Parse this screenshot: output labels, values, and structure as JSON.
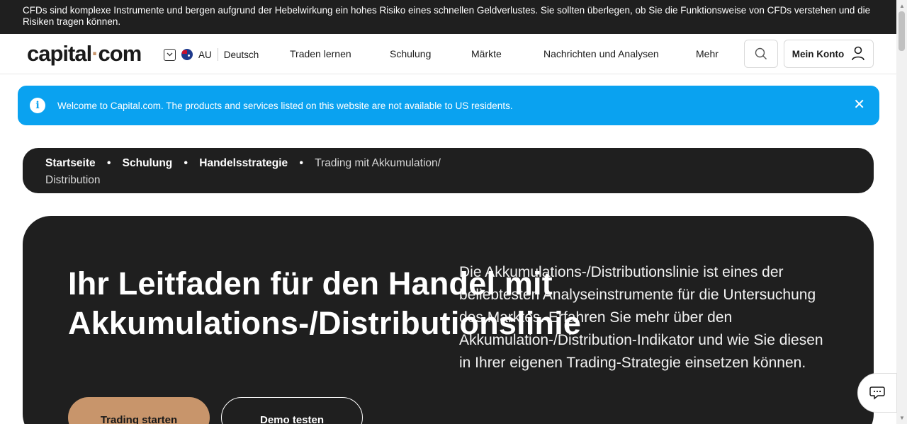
{
  "risk_warning": "CFDs sind komplexe Instrumente und bergen aufgrund der Hebelwirkung ein hohes Risiko eines schnellen Geldverlustes. Sie sollten überlegen, ob Sie die Funktionsweise von CFDs verstehen und die Risiken tragen können.",
  "header": {
    "logo_left": "capital",
    "logo_dot": "·",
    "logo_right": "com",
    "country": "AU",
    "language": "Deutsch",
    "nav": [
      "Traden lernen",
      "Schulung",
      "Märkte",
      "Nachrichten und Analysen",
      "Mehr"
    ],
    "account_label": "Mein Konto"
  },
  "notice": {
    "text": "Welcome to Capital.com. The products and services listed on this website are not available to US residents.",
    "info_symbol": "i",
    "close_symbol": "✕"
  },
  "breadcrumb": {
    "items": [
      "Startseite",
      "Schulung",
      "Handelsstrategie"
    ],
    "current": "Trading mit Akkumulation/ Distribution",
    "separator": "•"
  },
  "hero": {
    "title": "Ihr Leitfaden für den Handel mit Akkumulations-/Distributionslinie",
    "description": "Die Akkumulations-/Distributionslinie ist eines der beliebtesten Analyseinstrumente für die Untersuchung des Marktes. Erfahren Sie mehr über den Akkumulation-/Distribution-Indikator und wie Sie diesen in Ihrer eigenen Trading-Strategie einsetzen können.",
    "primary_button": "Trading starten",
    "secondary_button": "Demo testen"
  },
  "icons": {
    "region_chevron": "chevron-down-icon",
    "flag": "australia-flag-icon",
    "search": "search-icon",
    "account": "user-icon",
    "info": "info-icon",
    "close": "close-icon",
    "chat": "chat-icon"
  },
  "colors": {
    "dark": "#1f1f1f",
    "accent": "#c8956b",
    "notice_blue": "#0aa2f0"
  }
}
